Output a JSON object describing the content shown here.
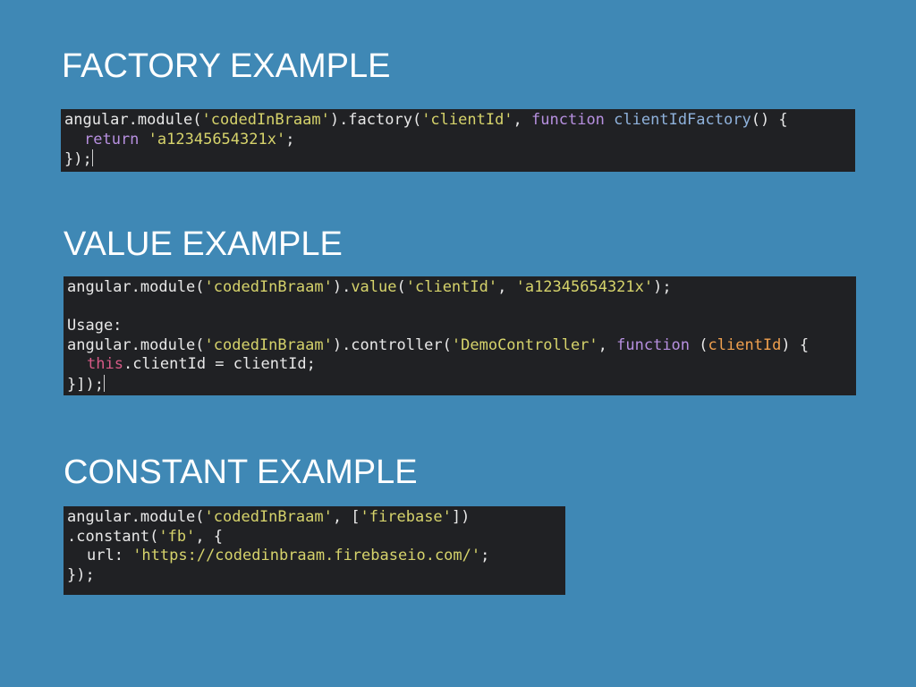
{
  "colors": {
    "background": "#3f88b5",
    "code_background": "#202124",
    "heading_text": "#ffffff",
    "code_plain": "#e8e8e8",
    "code_string": "#d6d36b",
    "code_keyword": "#b790e0",
    "code_function_name": "#8fb2dc",
    "code_this": "#d65a86",
    "code_parameter": "#f0a04e"
  },
  "sections": [
    {
      "heading": "FACTORY EXAMPLE",
      "lines": [
        {
          "indent": false,
          "cursor": false,
          "tokens": [
            {
              "t": "plain",
              "v": "angular.module("
            },
            {
              "t": "str",
              "v": "'codedInBraam'"
            },
            {
              "t": "plain",
              "v": ").factory("
            },
            {
              "t": "str",
              "v": "'clientId'"
            },
            {
              "t": "plain",
              "v": ", "
            },
            {
              "t": "kw",
              "v": "function"
            },
            {
              "t": "plain",
              "v": " "
            },
            {
              "t": "fn",
              "v": "clientIdFactory"
            },
            {
              "t": "plain",
              "v": "() {"
            }
          ]
        },
        {
          "indent": true,
          "cursor": false,
          "tokens": [
            {
              "t": "kw",
              "v": "return"
            },
            {
              "t": "plain",
              "v": " "
            },
            {
              "t": "str",
              "v": "'a12345654321x'"
            },
            {
              "t": "plain",
              "v": ";"
            }
          ]
        },
        {
          "indent": false,
          "cursor": true,
          "tokens": [
            {
              "t": "plain",
              "v": "});"
            }
          ]
        }
      ]
    },
    {
      "heading": "VALUE EXAMPLE",
      "lines": [
        {
          "indent": false,
          "cursor": false,
          "tokens": [
            {
              "t": "plain",
              "v": "angular.module("
            },
            {
              "t": "str",
              "v": "'codedInBraam'"
            },
            {
              "t": "plain",
              "v": ")."
            },
            {
              "t": "str",
              "v": "value"
            },
            {
              "t": "plain",
              "v": "("
            },
            {
              "t": "str",
              "v": "'clientId'"
            },
            {
              "t": "plain",
              "v": ", "
            },
            {
              "t": "str",
              "v": "'a12345654321x'"
            },
            {
              "t": "plain",
              "v": ");"
            }
          ]
        },
        {
          "indent": false,
          "cursor": false,
          "tokens": []
        },
        {
          "indent": false,
          "cursor": false,
          "tokens": [
            {
              "t": "plain",
              "v": "Usage:"
            }
          ]
        },
        {
          "indent": false,
          "cursor": false,
          "tokens": [
            {
              "t": "plain",
              "v": "angular.module("
            },
            {
              "t": "str",
              "v": "'codedInBraam'"
            },
            {
              "t": "plain",
              "v": ").controller("
            },
            {
              "t": "str",
              "v": "'DemoController'"
            },
            {
              "t": "plain",
              "v": ", "
            },
            {
              "t": "kw",
              "v": "function"
            },
            {
              "t": "plain",
              "v": " ("
            },
            {
              "t": "param",
              "v": "clientId"
            },
            {
              "t": "plain",
              "v": ") {"
            }
          ]
        },
        {
          "indent": true,
          "cursor": false,
          "tokens": [
            {
              "t": "this",
              "v": "this"
            },
            {
              "t": "plain",
              "v": ".clientId = clientId;"
            }
          ]
        },
        {
          "indent": false,
          "cursor": true,
          "tokens": [
            {
              "t": "plain",
              "v": "}]);"
            }
          ]
        }
      ]
    },
    {
      "heading": "CONSTANT EXAMPLE",
      "lines": [
        {
          "indent": false,
          "cursor": false,
          "tokens": [
            {
              "t": "plain",
              "v": "angular.module("
            },
            {
              "t": "str",
              "v": "'codedInBraam'"
            },
            {
              "t": "plain",
              "v": ", ["
            },
            {
              "t": "str",
              "v": "'firebase'"
            },
            {
              "t": "plain",
              "v": "])"
            }
          ]
        },
        {
          "indent": false,
          "cursor": false,
          "tokens": [
            {
              "t": "plain",
              "v": ".constant("
            },
            {
              "t": "str",
              "v": "'fb'"
            },
            {
              "t": "plain",
              "v": ", {"
            }
          ]
        },
        {
          "indent": true,
          "cursor": false,
          "tokens": [
            {
              "t": "plain",
              "v": "url: "
            },
            {
              "t": "str",
              "v": "'https://codedinbraam.firebaseio.com/'"
            },
            {
              "t": "plain",
              "v": ";"
            }
          ]
        },
        {
          "indent": false,
          "cursor": false,
          "tokens": [
            {
              "t": "plain",
              "v": "});"
            }
          ]
        }
      ]
    }
  ]
}
